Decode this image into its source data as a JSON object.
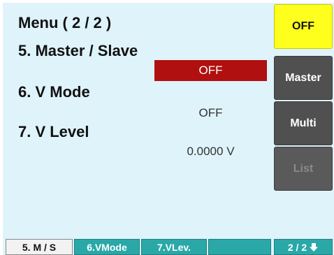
{
  "screen": {
    "title": "Menu ( 2 / 2 )",
    "params": [
      {
        "label": "5. Master / Slave",
        "value": "OFF"
      },
      {
        "label": "6. V Mode",
        "value": "OFF"
      },
      {
        "label": "7. V Level",
        "value": "0.0000 V"
      }
    ]
  },
  "softkeys": [
    {
      "label": "OFF"
    },
    {
      "label": "Master"
    },
    {
      "label": "Multi"
    },
    {
      "label": "List"
    }
  ],
  "tabs": [
    {
      "label": "5. M / S"
    },
    {
      "label": "6.VMode"
    },
    {
      "label": "7.VLev."
    },
    {
      "label": ""
    },
    {
      "label": "2 / 2"
    }
  ],
  "colors": {
    "background": "#dff3fb",
    "selected_value": "#b01010",
    "softkey_active": "#ffff1e",
    "softkey": "#505050",
    "tab": "#2aa8a8"
  },
  "icons": {
    "page_down": "down-arrow-icon"
  }
}
